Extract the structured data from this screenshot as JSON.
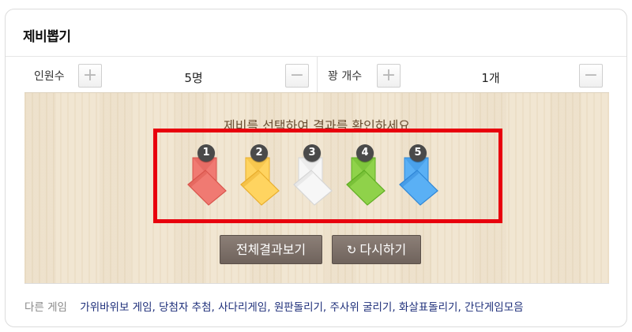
{
  "card": {
    "title": "제비뽑기"
  },
  "controls": {
    "people": {
      "label": "인원수",
      "value": "5명",
      "plus": "+",
      "minus": "−"
    },
    "winners": {
      "label": "꽝 개수",
      "value": "1개",
      "plus": "+",
      "minus": "−"
    }
  },
  "board": {
    "instruction": "제비를 선택하여 결과를 확인하세요",
    "lots": [
      {
        "number": "1",
        "color": "#f07a72",
        "dark": "#d9544c"
      },
      {
        "number": "2",
        "color": "#ffd460",
        "dark": "#e9ae2d"
      },
      {
        "number": "3",
        "color": "#f7f7f7",
        "dark": "#d6d6d6"
      },
      {
        "number": "4",
        "color": "#8fd24a",
        "dark": "#5fae23"
      },
      {
        "number": "5",
        "color": "#5ab0f5",
        "dark": "#2f86d6"
      }
    ],
    "all_results_label": "전체결과보기",
    "retry_label": "다시하기",
    "retry_icon": "refresh-icon"
  },
  "footer": {
    "label": "다른 게임",
    "links": [
      "가위바위보 게임",
      "당첨자 추첨",
      "사다리게임",
      "원판돌리기",
      "주사위 굴리기",
      "화살표돌리기",
      "간단게임모음"
    ]
  }
}
